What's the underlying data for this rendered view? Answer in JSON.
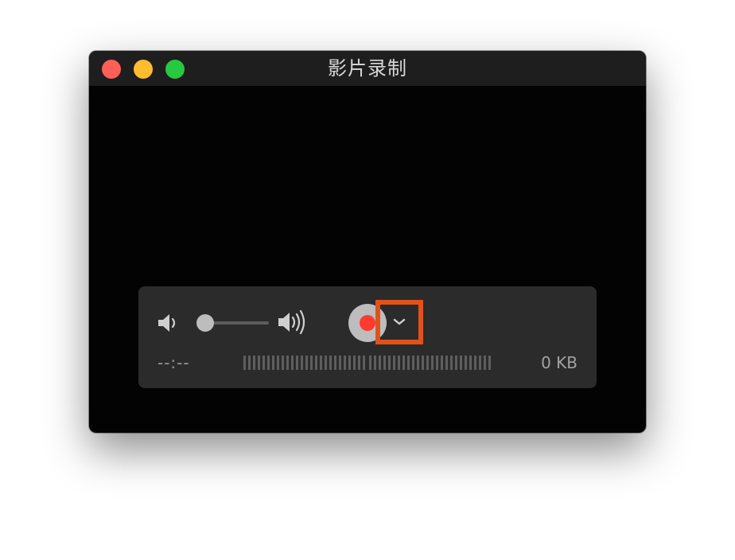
{
  "window": {
    "title": "影片录制"
  },
  "controls": {
    "volume_low_icon": "speaker-low-icon",
    "volume_high_icon": "speaker-high-icon",
    "volume_level": 0.1,
    "record_icon": "record-icon",
    "dropdown_icon": "chevron-down-icon",
    "elapsed_time": "--:--",
    "file_size": "0 KB"
  },
  "colors": {
    "record_red": "#ff3b30",
    "highlight_orange": "#e0521a",
    "close": "#fe5f57",
    "minimize": "#febc2e",
    "maximize": "#28c840"
  }
}
